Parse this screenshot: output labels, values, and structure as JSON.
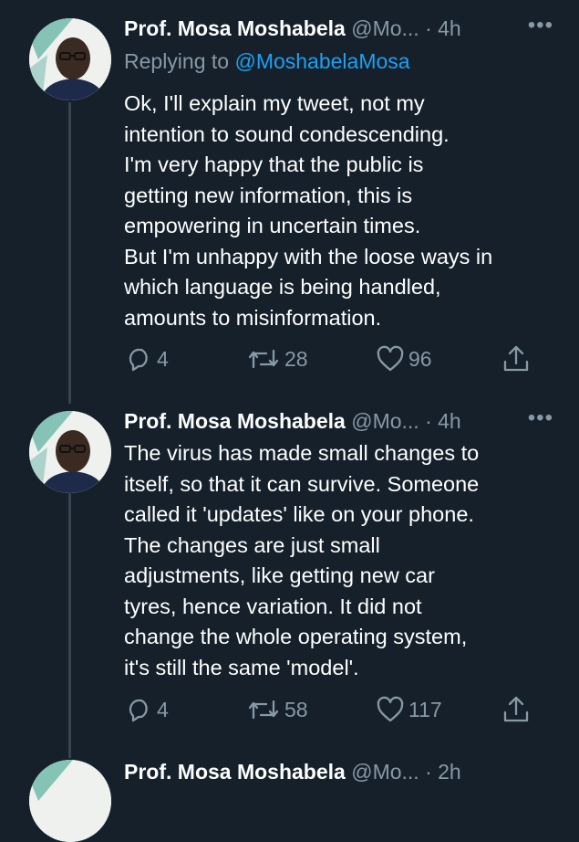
{
  "tweets": [
    {
      "name": "Prof. Mosa Moshabela",
      "handle": "@Mo...",
      "time": "· 4h",
      "more": "•••",
      "reply_prefix": "Replying to",
      "reply_to": "@MoshabelaMosa",
      "lines": [
        "Ok, I'll explain my tweet, not my",
        "intention to sound condescending.",
        "I'm very happy that the public is",
        "getting new information, this is",
        "empowering in uncertain times.",
        "But I'm unhappy with the loose ways in",
        "which language is being handled,",
        "amounts to misinformation."
      ],
      "replies": "4",
      "retweets": "28",
      "likes": "96"
    },
    {
      "name": "Prof. Mosa Moshabela",
      "handle": "@Mo...",
      "time": "· 4h",
      "more": "•••",
      "lines": [
        "The virus has made small changes to",
        "itself, so that it can survive. Someone",
        "called it 'updates' like on your phone.",
        "The changes are just small",
        "adjustments, like getting new car",
        "tyres, hence variation. It did not",
        "change the whole operating system,",
        "it's still the same 'model'."
      ],
      "replies": "4",
      "retweets": "58",
      "likes": "117"
    },
    {
      "name": "Prof. Mosa Moshabela",
      "handle": "@Mo...",
      "time": "· 2h"
    }
  ],
  "colors": {
    "background": "#15202b",
    "text": "#ffffff",
    "secondary": "#8899a6",
    "link": "#1da1f2",
    "thread_line": "#38444d"
  },
  "icons": [
    "reply-icon",
    "retweet-icon",
    "like-icon",
    "share-icon",
    "more-icon"
  ]
}
